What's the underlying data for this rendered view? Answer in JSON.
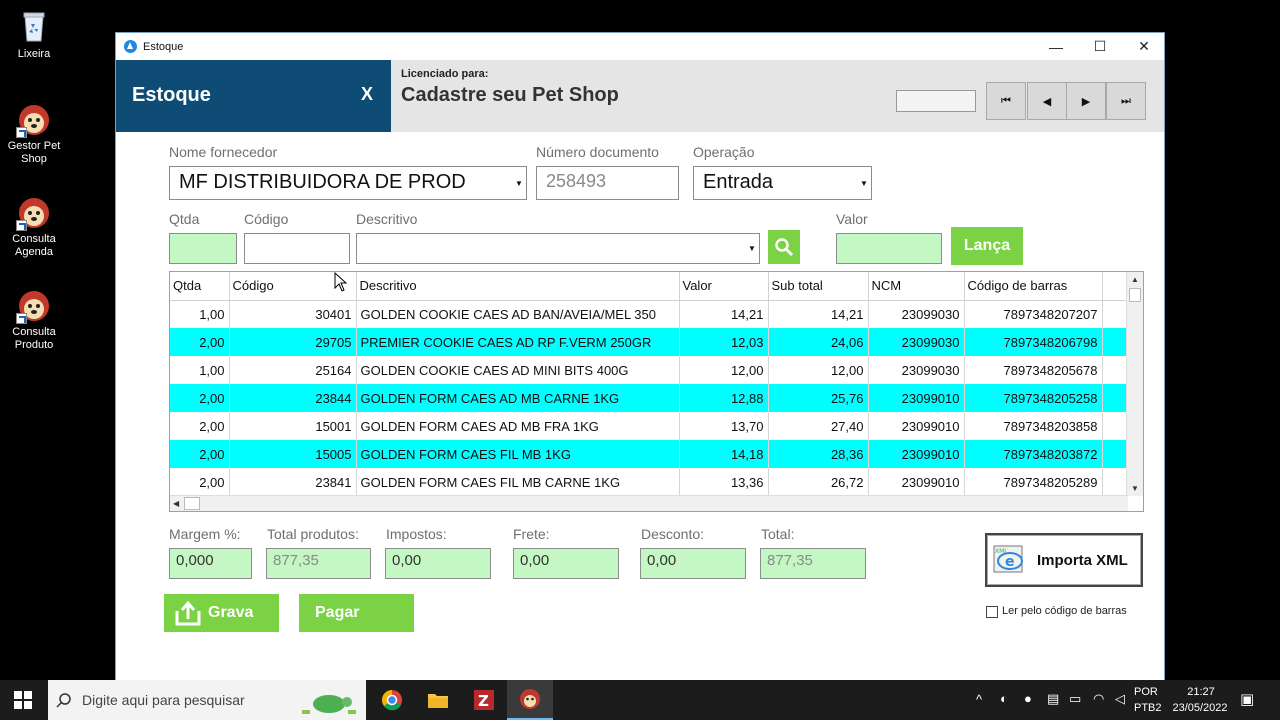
{
  "desktop": {
    "icons": [
      {
        "label": "Lixeira"
      },
      {
        "label": "Gestor Pet Shop"
      },
      {
        "label": "Consulta Agenda"
      },
      {
        "label": "Consulta Produto"
      }
    ]
  },
  "window": {
    "title": "Estoque",
    "controls": {
      "minimize": "—",
      "maximize": "☐",
      "close": "✕"
    }
  },
  "header": {
    "panel_title": "Estoque",
    "close_label": "X",
    "license_label": "Licenciado para:",
    "license_value": "Cadastre seu Pet Shop",
    "nav": {
      "first": "⏮",
      "prev": "◀",
      "next": "▶",
      "last": "⏭"
    }
  },
  "form": {
    "fornecedor_label": "Nome fornecedor",
    "fornecedor_value": "MF DISTRIBUIDORA DE PROD",
    "documento_label": "Número documento",
    "documento_value": "258493",
    "operacao_label": "Operação",
    "operacao_value": "Entrada",
    "qtda_label": "Qtda",
    "codigo_label": "Código",
    "descritivo_label": "Descritivo",
    "valor_label": "Valor",
    "lanca_label": "Lança"
  },
  "grid": {
    "columns": [
      "Qtda",
      "Código",
      "Descritivo",
      "Valor",
      "Sub total",
      "NCM",
      "Código de barras"
    ],
    "rows": [
      {
        "qtda": "1,00",
        "codigo": "30401",
        "descritivo": "GOLDEN COOKIE CAES AD BAN/AVEIA/MEL 350",
        "valor": "14,21",
        "subtotal": "14,21",
        "ncm": "23099030",
        "barras": "7897348207207"
      },
      {
        "qtda": "2,00",
        "codigo": "29705",
        "descritivo": "PREMIER COOKIE CAES AD RP F.VERM 250GR",
        "valor": "12,03",
        "subtotal": "24,06",
        "ncm": "23099030",
        "barras": "7897348206798"
      },
      {
        "qtda": "1,00",
        "codigo": "25164",
        "descritivo": "GOLDEN COOKIE CAES AD MINI BITS 400G",
        "valor": "12,00",
        "subtotal": "12,00",
        "ncm": "23099030",
        "barras": "7897348205678"
      },
      {
        "qtda": "2,00",
        "codigo": "23844",
        "descritivo": "GOLDEN FORM CAES AD MB CARNE 1KG",
        "valor": "12,88",
        "subtotal": "25,76",
        "ncm": "23099010",
        "barras": "7897348205258"
      },
      {
        "qtda": "2,00",
        "codigo": "15001",
        "descritivo": "GOLDEN FORM CAES AD MB FRA 1KG",
        "valor": "13,70",
        "subtotal": "27,40",
        "ncm": "23099010",
        "barras": "7897348203858"
      },
      {
        "qtda": "2,00",
        "codigo": "15005",
        "descritivo": "GOLDEN FORM CAES FIL MB 1KG",
        "valor": "14,18",
        "subtotal": "28,36",
        "ncm": "23099010",
        "barras": "7897348203872"
      },
      {
        "qtda": "2,00",
        "codigo": "23841",
        "descritivo": "GOLDEN FORM CAES FIL MB CARNE 1KG",
        "valor": "13,36",
        "subtotal": "26,72",
        "ncm": "23099010",
        "barras": "7897348205289"
      }
    ]
  },
  "totals": {
    "margem_label": "Margem %:",
    "margem_value": "0,000",
    "total_produtos_label": "Total produtos:",
    "total_produtos_value": "877,35",
    "impostos_label": "Impostos:",
    "impostos_value": "0,00",
    "frete_label": "Frete:",
    "frete_value": "0,00",
    "desconto_label": "Desconto:",
    "desconto_value": "0,00",
    "total_label": "Total:",
    "total_value": "877,35"
  },
  "actions": {
    "grava_label": "Grava",
    "pagar_label": "Pagar",
    "importa_xml_label": "Importa XML",
    "barcode_checkbox_label": "Ler pelo código de barras"
  },
  "taskbar": {
    "search_placeholder": "Digite aqui para pesquisar",
    "lang_top": "POR",
    "lang_bottom": "PTB2",
    "time": "21:27",
    "date": "23/05/2022"
  },
  "colors": {
    "header_blue": "#0f4c75",
    "accent_green": "#7ad244",
    "row_highlight": "#00ffff",
    "field_green": "#c4f7c4"
  }
}
